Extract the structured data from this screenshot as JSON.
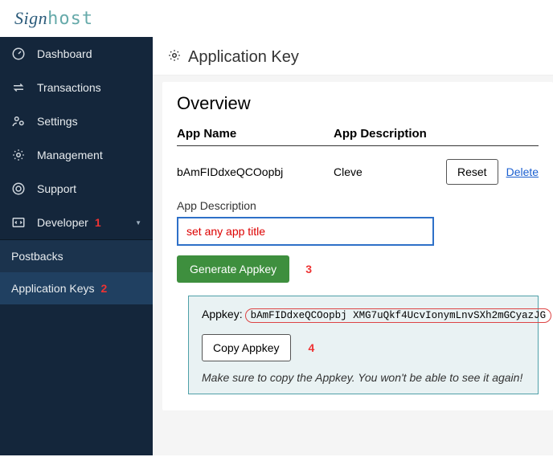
{
  "logo": {
    "a": "Sign",
    "b": "host"
  },
  "sidebar": {
    "items": [
      {
        "label": "Dashboard"
      },
      {
        "label": "Transactions"
      },
      {
        "label": "Settings"
      },
      {
        "label": "Management"
      },
      {
        "label": "Support"
      },
      {
        "label": "Developer"
      }
    ],
    "sub": [
      {
        "label": "Postbacks"
      },
      {
        "label": "Application Keys"
      }
    ]
  },
  "annots": {
    "one": "1",
    "two": "2",
    "three": "3",
    "four": "4"
  },
  "header": {
    "title": "Application Key"
  },
  "overview": {
    "heading": "Overview",
    "col_app_name": "App Name",
    "col_app_desc": "App Description",
    "row": {
      "name": "bAmFIDdxeQCOopbj",
      "desc": "Cleve",
      "reset": "Reset",
      "delete": "Delete"
    },
    "form_label": "App Description",
    "input_value": "set any app title",
    "generate": "Generate Appkey",
    "appkey_label": "Appkey:",
    "appkey_value": "bAmFIDdxeQCOopbj XMG7uQkf4UcvIonymLnvSXh2mGCyazJG",
    "copy": "Copy Appkey",
    "note": "Make sure to copy the Appkey. You won't be able to see it again!"
  }
}
